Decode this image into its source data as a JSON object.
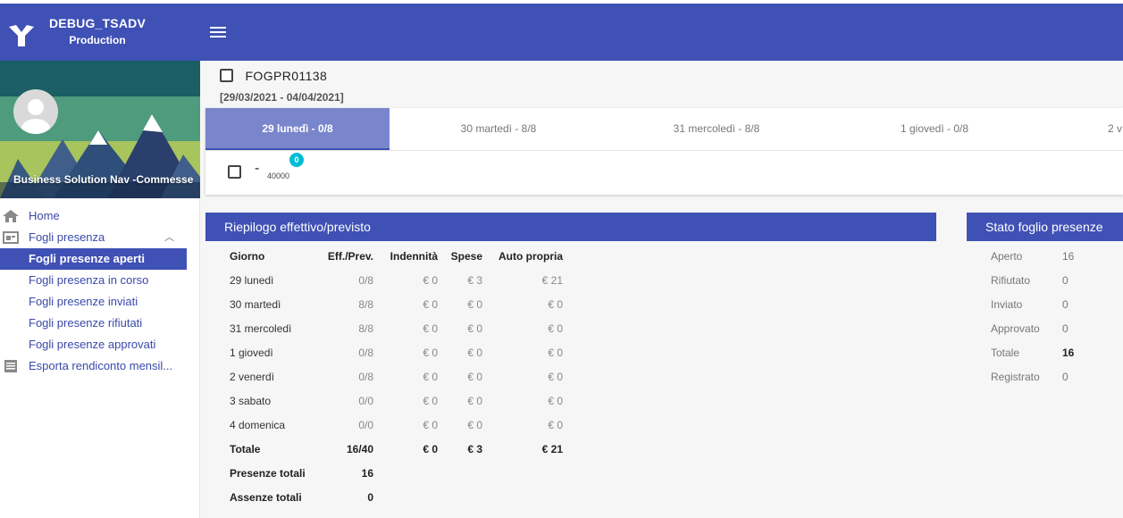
{
  "app": {
    "name": "DEBUG_TSADV",
    "environment": "Production"
  },
  "colors": {
    "primary": "#3f51b5",
    "tab_active": "#7986cb",
    "badge": "#00bcd4"
  },
  "sidebar": {
    "company": "Business Solution Nav -Commesse",
    "items": [
      {
        "label": "Home",
        "icon": "home-icon"
      },
      {
        "label": "Fogli presenza",
        "icon": "timesheet-icon"
      },
      {
        "label": "Fogli presenze aperti"
      },
      {
        "label": "Fogli presenza in corso"
      },
      {
        "label": "Fogli presenze inviati"
      },
      {
        "label": "Fogli presenze rifiutati"
      },
      {
        "label": "Fogli presenze approvati"
      },
      {
        "label": "Esporta rendiconto mensil...",
        "icon": "list-icon"
      }
    ]
  },
  "sheet": {
    "code": "FOGPR01138",
    "range": "[29/03/2021 - 04/04/2021]",
    "tabs": [
      {
        "label": "29 lunedì - 0/8"
      },
      {
        "label": "30 martedì - 8/8"
      },
      {
        "label": "31 mercoledì - 8/8"
      },
      {
        "label": "1 giovedì - 0/8"
      },
      {
        "label": "2 v"
      }
    ],
    "entry": {
      "dash": "-",
      "code": "40000",
      "badge": "0"
    }
  },
  "summary": {
    "title": "Riepilogo effettivo/previsto",
    "headers": [
      "Giorno",
      "Eff./Prev.",
      "Indennità",
      "Spese",
      "Auto propria"
    ],
    "rows": [
      [
        "29 lunedì",
        "0/8",
        "€ 0",
        "€ 3",
        "€ 21"
      ],
      [
        "30 martedì",
        "8/8",
        "€ 0",
        "€ 0",
        "€ 0"
      ],
      [
        "31 mercoledì",
        "8/8",
        "€ 0",
        "€ 0",
        "€ 0"
      ],
      [
        "1 giovedì",
        "0/8",
        "€ 0",
        "€ 0",
        "€ 0"
      ],
      [
        "2 venerdì",
        "0/8",
        "€ 0",
        "€ 0",
        "€ 0"
      ],
      [
        "3 sabato",
        "0/0",
        "€ 0",
        "€ 0",
        "€ 0"
      ],
      [
        "4 domenica",
        "0/0",
        "€ 0",
        "€ 0",
        "€ 0"
      ]
    ],
    "total": [
      "Totale",
      "16/40",
      "€ 0",
      "€ 3",
      "€ 21"
    ],
    "presenze": [
      "Presenze totali",
      "16"
    ],
    "assenze": [
      "Assenze totali",
      "0"
    ]
  },
  "status": {
    "title": "Stato foglio presenze",
    "rows": [
      [
        "Aperto",
        "16"
      ],
      [
        "Rifiutato",
        "0"
      ],
      [
        "Inviato",
        "0"
      ],
      [
        "Approvato",
        "0"
      ],
      [
        "Totale",
        "16"
      ],
      [
        "Registrato",
        "0"
      ]
    ]
  }
}
